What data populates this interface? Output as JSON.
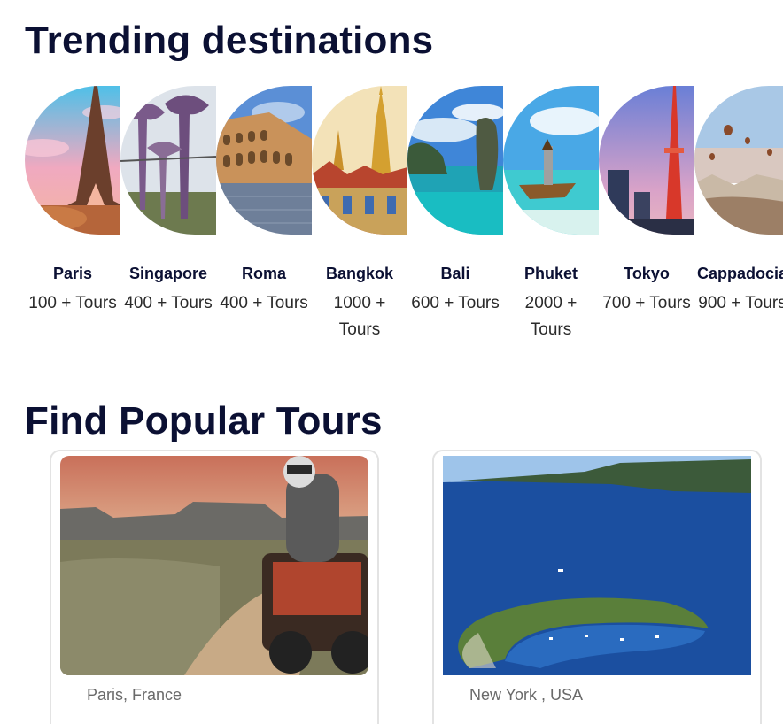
{
  "sections": {
    "trending_title": "Trending destinations",
    "popular_title": "Find Popular Tours"
  },
  "destinations": [
    {
      "name": "Paris",
      "count": "100 + Tours",
      "image": "eiffel-tower-photo"
    },
    {
      "name": "Singapore",
      "count": "400 + Tours",
      "image": "supertree-grove-photo"
    },
    {
      "name": "Roma",
      "count": "400 + Tours",
      "image": "colosseum-photo"
    },
    {
      "name": "Bangkok",
      "count": "1000 + Tours",
      "image": "grand-palace-photo"
    },
    {
      "name": "Bali",
      "count": "600 + Tours",
      "image": "limestone-karst-photo"
    },
    {
      "name": "Phuket",
      "count": "2000 + Tours",
      "image": "longtail-boat-photo"
    },
    {
      "name": "Tokyo",
      "count": "700 + Tours",
      "image": "tokyo-tower-photo"
    },
    {
      "name": "Cappadocia",
      "count": "900 + Tours",
      "image": "hot-air-balloons-photo"
    }
  ],
  "tours": [
    {
      "location": "Paris, France",
      "image": "atv-desert-photo"
    },
    {
      "location": "New York , USA",
      "image": "crater-island-photo"
    }
  ]
}
